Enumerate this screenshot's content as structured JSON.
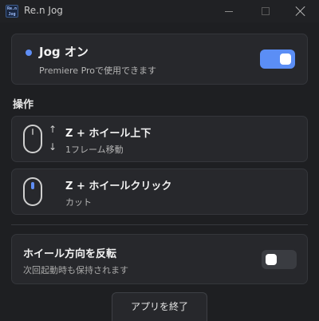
{
  "window": {
    "title": "Re.n Jog",
    "icon_text": "Re.n\nJog"
  },
  "jog": {
    "title": "Jog オン",
    "subtitle": "Premiere Proで使用できます",
    "enabled": true,
    "accent": "#5b8ef5"
  },
  "operations": {
    "label": "操作",
    "items": [
      {
        "title": "Z + ホイール上下",
        "subtitle": "1フレーム移動",
        "icon": "mouse-scroll-icon"
      },
      {
        "title": "Z + ホイールクリック",
        "subtitle": "カット",
        "icon": "mouse-click-icon"
      }
    ]
  },
  "invert": {
    "title": "ホイール方向を反転",
    "subtitle": "次回起動時も保持されます",
    "enabled": false
  },
  "footer": {
    "quit_label": "アプリを終了"
  },
  "glyphs": {
    "arrow_up": "↑",
    "arrow_down": "↓"
  }
}
